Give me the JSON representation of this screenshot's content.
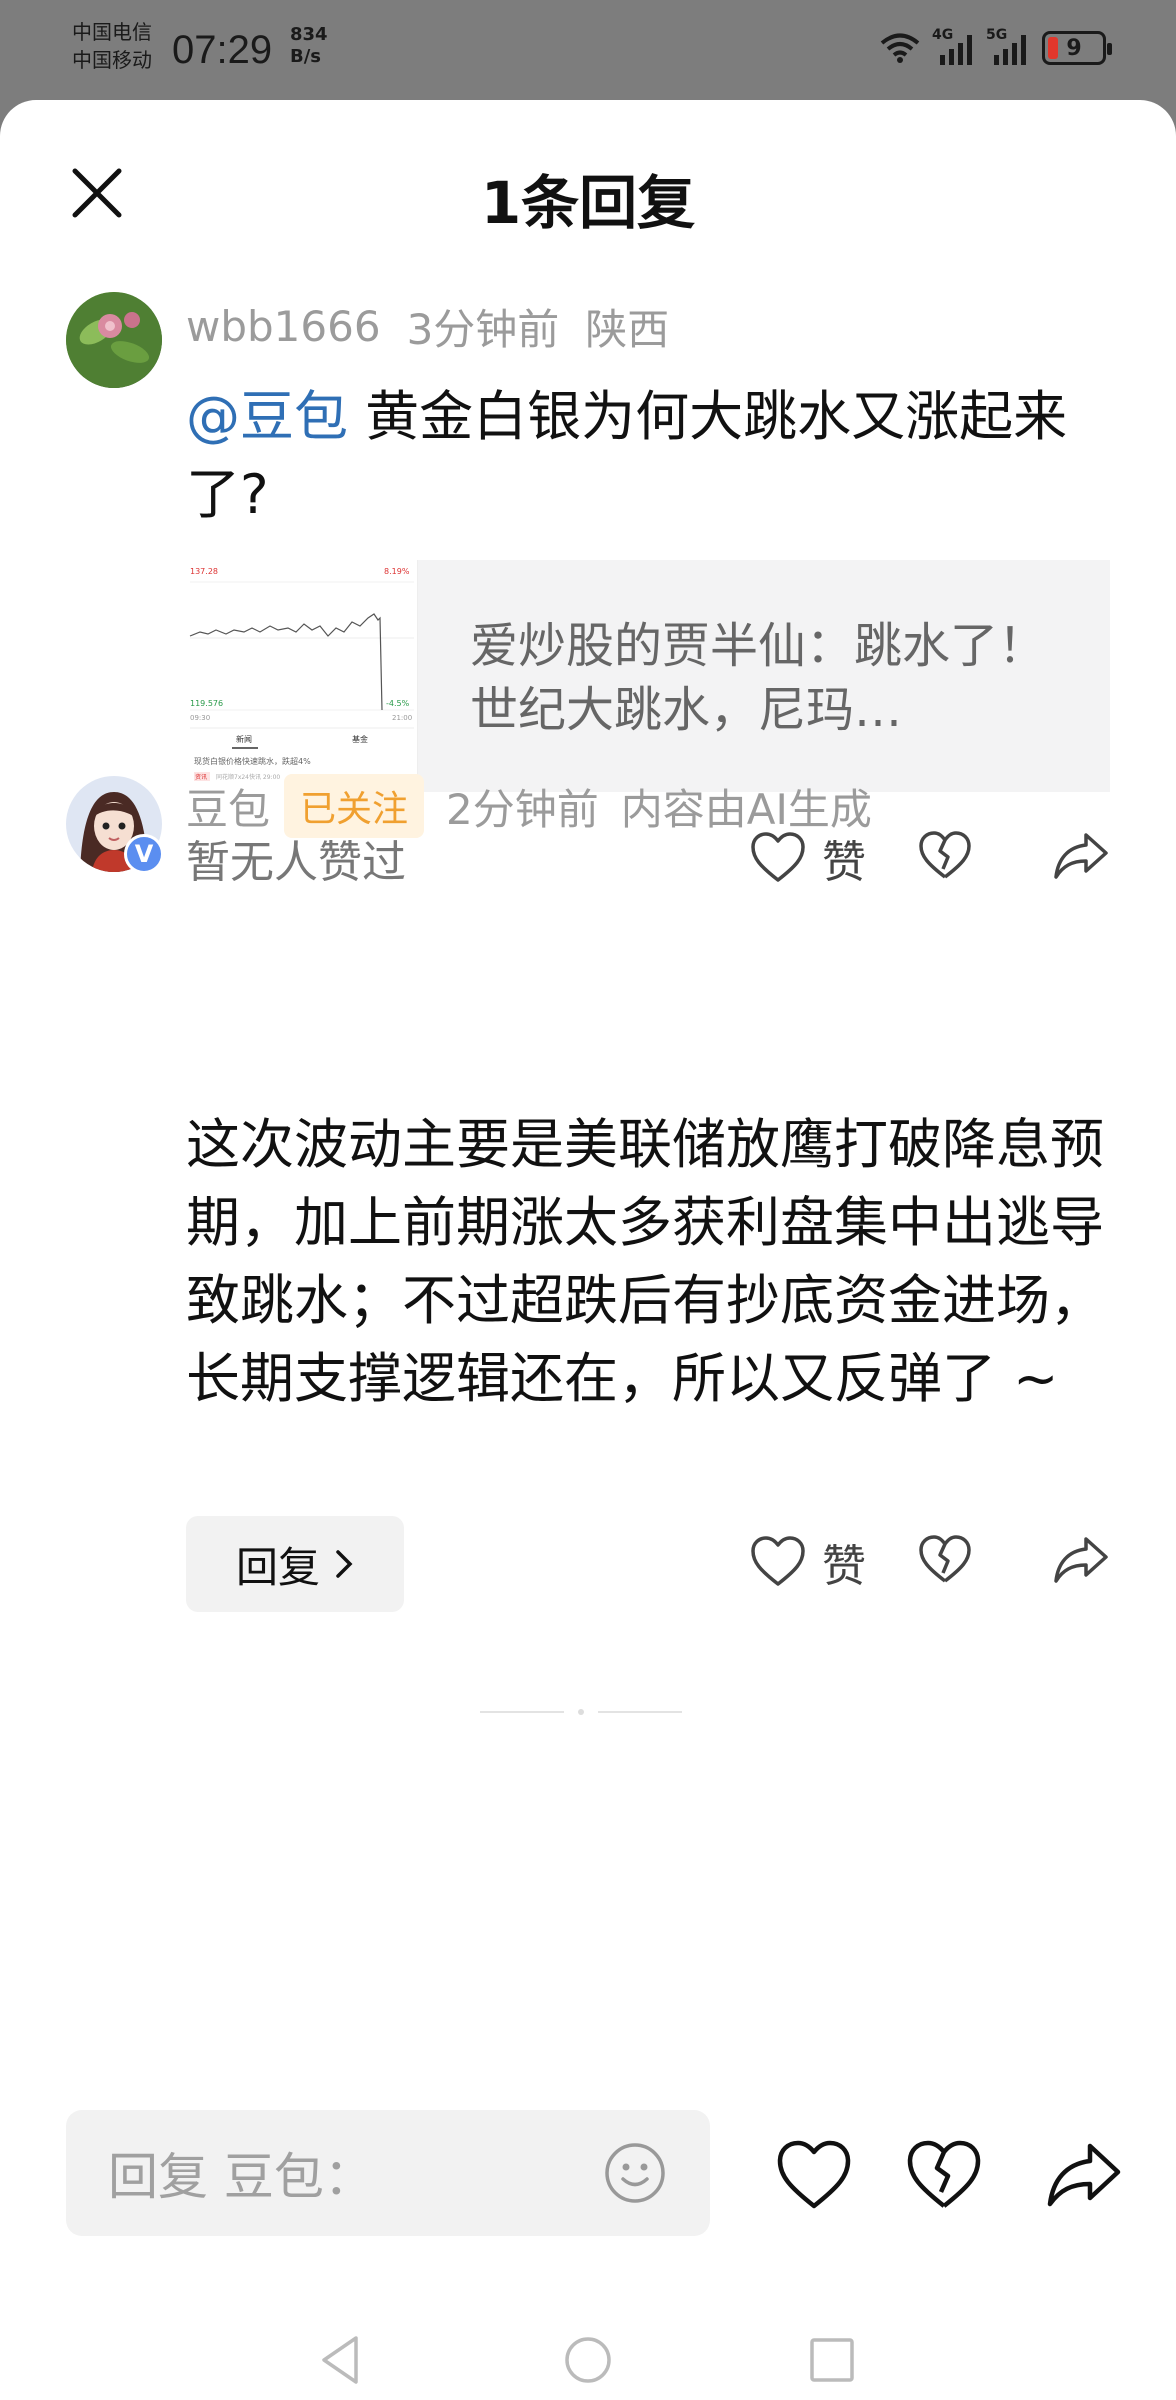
{
  "status_bar": {
    "carrier_1": "中国电信",
    "carrier_2": "中国移动",
    "time": "07:29",
    "speed_value": "834",
    "speed_unit": "B/s",
    "net_1": "4G",
    "net_2": "5G",
    "battery": "9",
    "battery_color": "#e2372c"
  },
  "sheet": {
    "title": "1条回复",
    "close_icon": "close-icon"
  },
  "comment": {
    "username": "wbb1666",
    "time": "3分钟前",
    "location": "陕西",
    "mention": "@豆包",
    "text": " 黄金白银为何大跳水又涨起来了?",
    "link_card": {
      "title": "爱炒股的贾半仙：跳水了！世纪大跳水，尼玛…",
      "thumb": {
        "price_top": "137.28",
        "change_top": "8.19%",
        "price_bottom": "119.576",
        "change_bottom": "-4.5%",
        "time_left": "09:30",
        "time_right": "21:00",
        "tab_1": "新闻",
        "tab_2": "基金",
        "news": "现货白银价格快速跳水，跌超4%",
        "tag": "资讯",
        "source": "同花顺7x24快讯 29:00"
      }
    },
    "likes_text": "暂无人赞过",
    "like_label": "赞"
  },
  "reply": {
    "username": "豆包",
    "follow_badge": "已关注",
    "time": "2分钟前",
    "ai_note": "内容由AI生成",
    "verified_badge": "V",
    "text": "这次波动主要是美联储放鹰打破降息预期，加上前期涨太多获利盘集中出逃导致跳水；不过超跌后有抄底资金进场，长期支撑逻辑还在，所以又反弹了 ~",
    "reply_button": "回复",
    "like_label": "赞"
  },
  "bottom_bar": {
    "placeholder": "回复 豆包："
  },
  "colors": {
    "mention": "#2f6fb5",
    "follow_text": "#f0a030",
    "follow_bg": "#fff3e0",
    "verified": "#5b8ef0"
  }
}
